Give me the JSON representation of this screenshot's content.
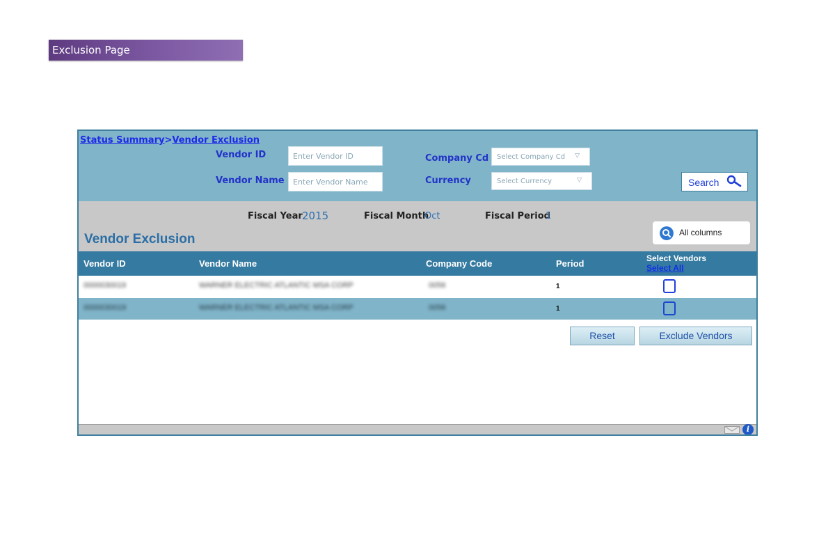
{
  "page": {
    "banner_title": "Exclusion Page"
  },
  "breadcrumb": {
    "parent": "Status Summary",
    "separator": ">",
    "current": "Vendor Exclusion"
  },
  "search": {
    "vendor_id_label": "Vendor ID",
    "vendor_id_placeholder": "Enter Vendor ID",
    "vendor_name_label": "Vendor Name",
    "vendor_name_placeholder": "Enter Vendor Name",
    "company_cd_label": "Company Cd",
    "company_cd_value": "Select Company Cd",
    "currency_label": "Currency",
    "currency_value": "Select Currency",
    "search_button": "Search"
  },
  "fiscal": {
    "year_label": "Fiscal Year",
    "year_value": "2015",
    "month_label": "Fiscal Month",
    "month_value": "Oct",
    "period_label": "Fiscal Period",
    "period_value": "1"
  },
  "section_title": "Vendor Exclusion",
  "all_columns_label": "All columns",
  "table": {
    "headers": {
      "vendor_id": "Vendor ID",
      "vendor_name": "Vendor Name",
      "company_code": "Company Code",
      "period": "Period",
      "select_vendors": "Select Vendors",
      "select_all": "Select All"
    },
    "rows": [
      {
        "vendor_id": "0000030019",
        "vendor_name": "WARNER ELECTRIC ATLANTIC MSA CORP",
        "company_code": "0056",
        "period": "1"
      },
      {
        "vendor_id": "0000030019",
        "vendor_name": "WARNER ELECTRIC ATLANTIC MSA CORP",
        "company_code": "0056",
        "period": "1"
      }
    ]
  },
  "actions": {
    "reset": "Reset",
    "exclude": "Exclude Vendors"
  },
  "icons": {
    "search": "search-icon",
    "all_columns": "magnifier-icon",
    "mail": "mail-icon",
    "info": "info-icon"
  },
  "colors": {
    "panel_blue": "#80b4c8",
    "header_blue": "#357aa0",
    "link_blue": "#1d2ae8",
    "banner_purple": "#6a4690"
  }
}
